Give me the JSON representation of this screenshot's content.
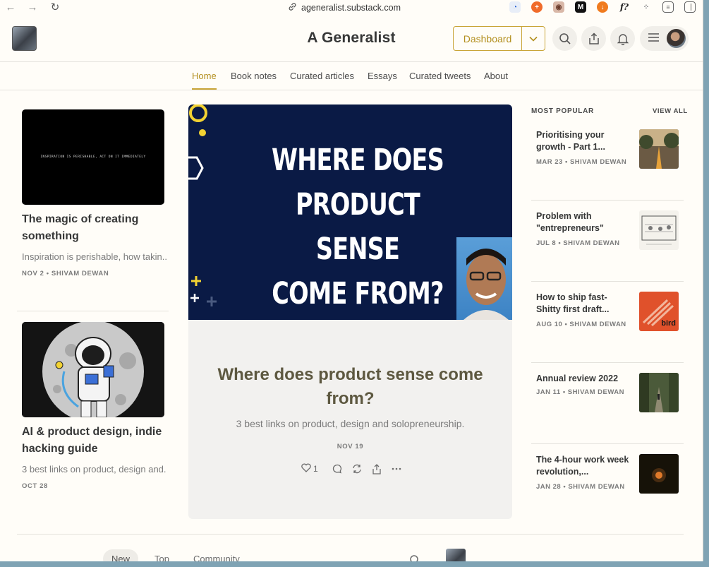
{
  "browser": {
    "url": "ageneralist.substack.com",
    "extensions": [
      "clock-icon",
      "plus-icon",
      "owl-icon",
      "m-icon",
      "download-icon",
      "f-icon",
      "dots-icon",
      "note-icon",
      "sidebar-icon"
    ],
    "f_label": "f?",
    "m_label": "M"
  },
  "header": {
    "site_title": "A Generalist",
    "dashboard_label": "Dashboard"
  },
  "nav": {
    "items": [
      "Home",
      "Book notes",
      "Curated articles",
      "Essays",
      "Curated tweets",
      "About"
    ],
    "active": "Home"
  },
  "left_posts": [
    {
      "image_text": "INSPIRATION IS PERISHABLE, ACT ON IT IMMEDIATELY",
      "title": "The magic of creating something",
      "subtitle": "Inspiration is perishable, how takin...",
      "meta": "NOV 2 • SHIVAM DEWAN"
    },
    {
      "title": "AI & product design, indie hacking guide",
      "subtitle": "3 best links on product, design and...",
      "meta": "OCT 28"
    }
  ],
  "hero": {
    "image_lines": [
      "WHERE DOES",
      "PRODUCT SENSE",
      "COME FROM?"
    ],
    "title": "Where does product sense come from?",
    "subtitle": "3 best links on product, design and solopreneurship.",
    "date": "NOV 19",
    "likes": "1"
  },
  "popular": {
    "heading": "MOST POPULAR",
    "view_all": "VIEW ALL",
    "items": [
      {
        "title": "Prioritising your growth - Part 1...",
        "meta": "MAR 23 • SHIVAM DEWAN"
      },
      {
        "title": "Problem with \"entrepreneurs\"",
        "meta": "JUL 8 • SHIVAM DEWAN"
      },
      {
        "title": "How to ship fast- Shitty first draft...",
        "meta": "AUG 10 • SHIVAM DEWAN",
        "thumb_text": "bird"
      },
      {
        "title": "Annual review 2022",
        "meta": "JAN 11 • SHIVAM DEWAN"
      },
      {
        "title": "The 4-hour work week revolution,...",
        "meta": "JAN 28 • SHIVAM DEWAN"
      }
    ]
  },
  "bottom_tabs": [
    "New",
    "Top",
    "Community"
  ],
  "colors": {
    "accent": "#c9a538",
    "hero_bg": "#0a1a45",
    "page_bg": "#fffdf8"
  }
}
